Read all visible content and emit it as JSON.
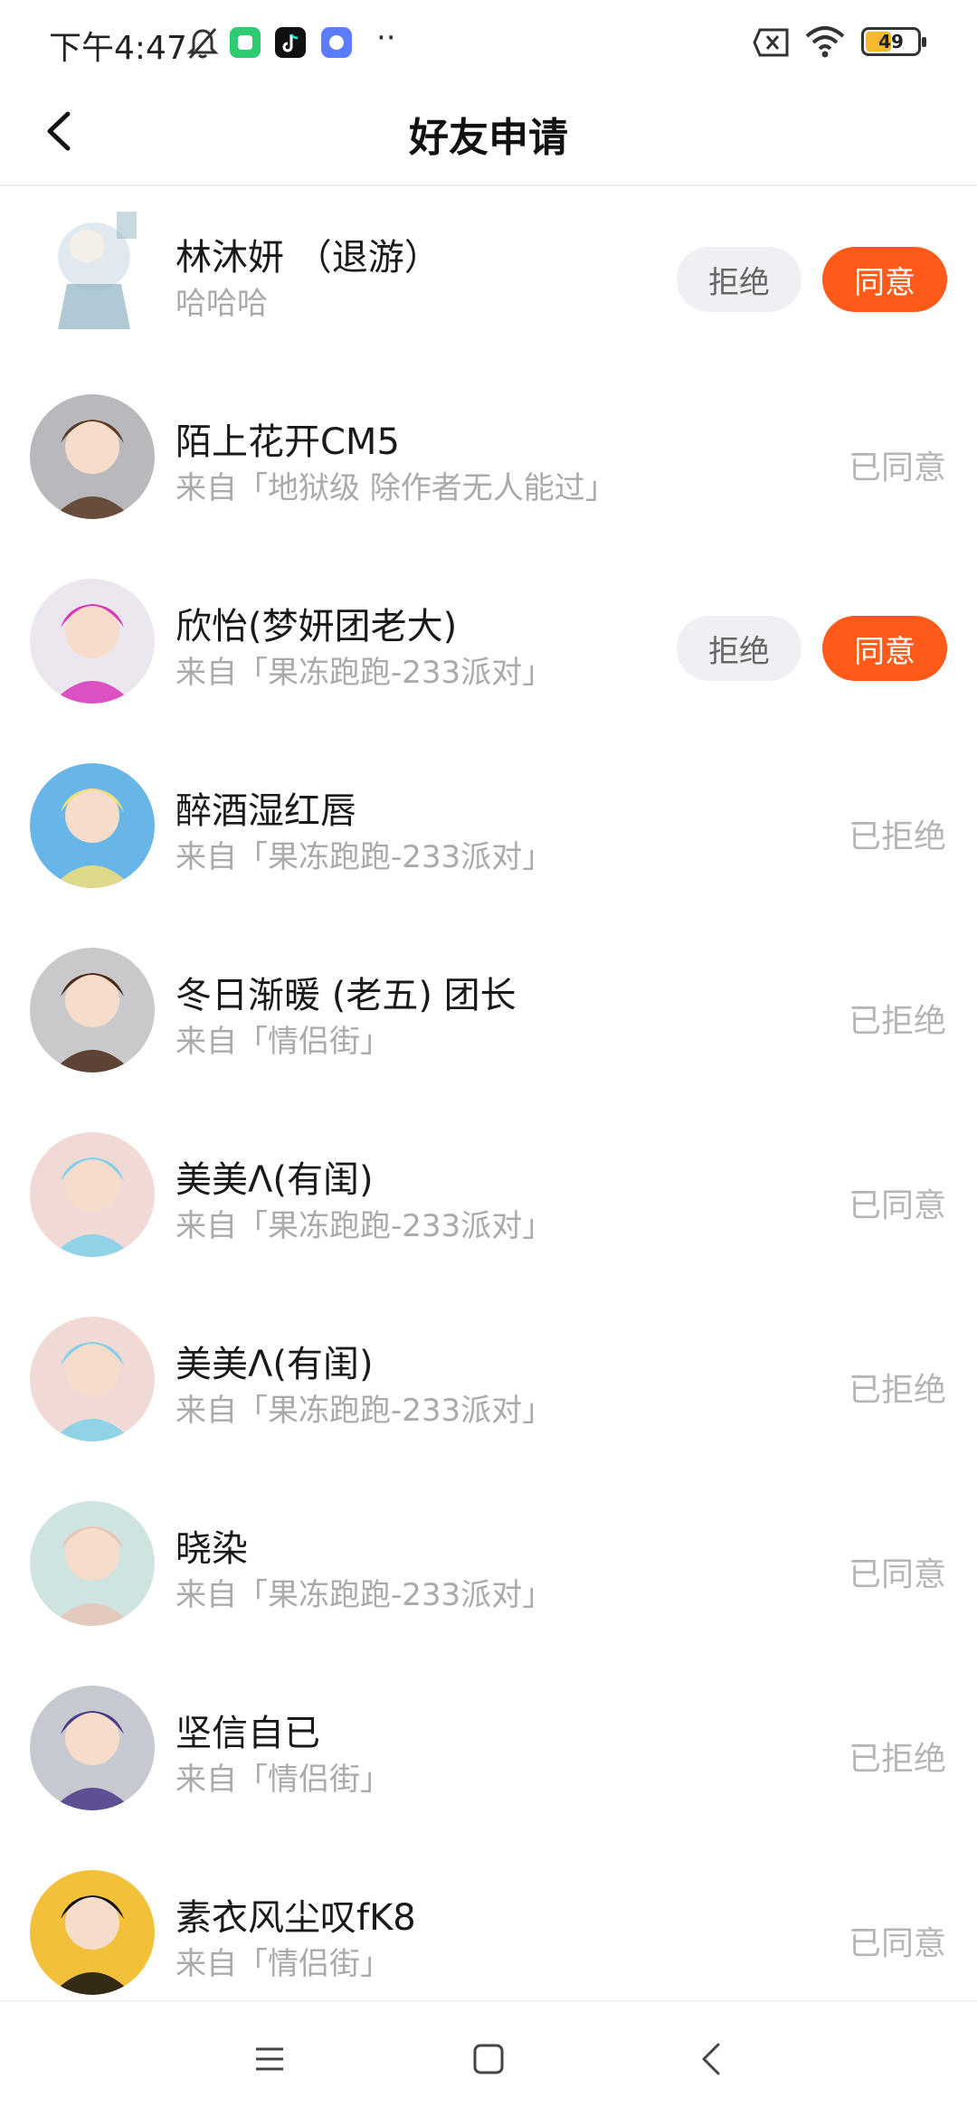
{
  "status_bar": {
    "time": "下午4:47",
    "battery": "49",
    "battery_level_percent": 49,
    "icons": [
      "bell-muted-icon",
      "app-notification-icon",
      "tiktok-icon",
      "app-chat-icon",
      "more-dots-icon",
      "sim-off-icon",
      "wifi-icon",
      "battery-icon"
    ],
    "dots": "··"
  },
  "header": {
    "title": "好友申请",
    "back_icon": "chevron-left-icon"
  },
  "buttons": {
    "reject": "拒绝",
    "accept": "同意"
  },
  "requests": [
    {
      "name": "林沐妍 （退游）",
      "subtitle": "哈哈哈",
      "status": "",
      "pending": true,
      "avatar_colors": [
        "#dfe9ef",
        "#8fb3c3"
      ]
    },
    {
      "name": "陌上花开CM5",
      "subtitle": "来自「地狱级  除作者无人能过」",
      "status": "已同意",
      "pending": false,
      "avatar_colors": [
        "#b9b9bd",
        "#5a3a24"
      ]
    },
    {
      "name": "欣怡(梦妍团老大)",
      "subtitle": "来自「果冻跑跑-233派对」",
      "status": "",
      "pending": true,
      "avatar_colors": [
        "#ece7ee",
        "#d936b8"
      ]
    },
    {
      "name": "醉酒湿红唇",
      "subtitle": "来自「果冻跑跑-233派对」",
      "status": "已拒绝",
      "pending": false,
      "avatar_colors": [
        "#68b5e8",
        "#f4e07a"
      ]
    },
    {
      "name": "冬日渐暖 (老五) 团长",
      "subtitle": "来自「情侣街」",
      "status": "已拒绝",
      "pending": false,
      "avatar_colors": [
        "#c9c9cc",
        "#4a2a1a"
      ]
    },
    {
      "name": "美美ᐱ(有闺)",
      "subtitle": "来自「果冻跑跑-233派对」",
      "status": "已同意",
      "pending": false,
      "avatar_colors": [
        "#f1d9d6",
        "#7fd1ea"
      ]
    },
    {
      "name": "美美ᐱ(有闺)",
      "subtitle": "来自「果冻跑跑-233派对」",
      "status": "已拒绝",
      "pending": false,
      "avatar_colors": [
        "#f1d9d6",
        "#7fd1ea"
      ]
    },
    {
      "name": "晓染",
      "subtitle": "来自「果冻跑跑-233派对」",
      "status": "已同意",
      "pending": false,
      "avatar_colors": [
        "#cfe3e0",
        "#e8c4b8"
      ]
    },
    {
      "name": "坚信自已",
      "subtitle": "来自「情侣街」",
      "status": "已拒绝",
      "pending": false,
      "avatar_colors": [
        "#c7c9d0",
        "#4b3a8a"
      ]
    },
    {
      "name": "素衣风尘叹fK8",
      "subtitle": "来自「情侣街」",
      "status": "已同意",
      "pending": false,
      "avatar_colors": [
        "#f3c03a",
        "#111111"
      ]
    }
  ],
  "nav_bar": {
    "icons": [
      "menu-icon",
      "home-square-icon",
      "back-triangle-icon"
    ]
  },
  "colors": {
    "accent": "#ff5a1a",
    "reject_bg": "#eef0f4",
    "muted_text": "#aaaaaa"
  }
}
